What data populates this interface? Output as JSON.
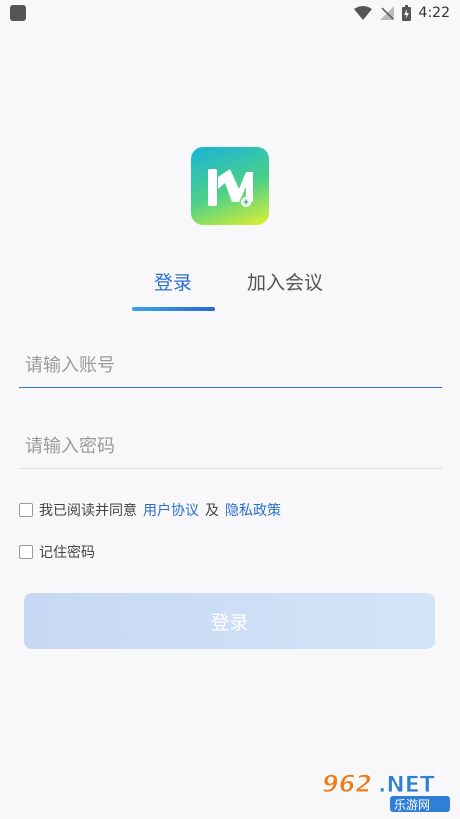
{
  "status_bar": {
    "time": "4:22"
  },
  "tabs": {
    "login": "登录",
    "join_meeting": "加入会议"
  },
  "form": {
    "account_placeholder": "请输入账号",
    "password_placeholder": "请输入密码"
  },
  "agreement": {
    "prefix": "我已阅读并同意",
    "user_agreement": "用户协议",
    "and": "及",
    "privacy_policy": "隐私政策"
  },
  "remember_password": "记住密码",
  "login_button": "登录",
  "watermark": {
    "brand": "962.NET",
    "sub": "乐游网"
  },
  "colors": {
    "accent": "#2b6fce",
    "button_bg": "#cddcf5"
  }
}
